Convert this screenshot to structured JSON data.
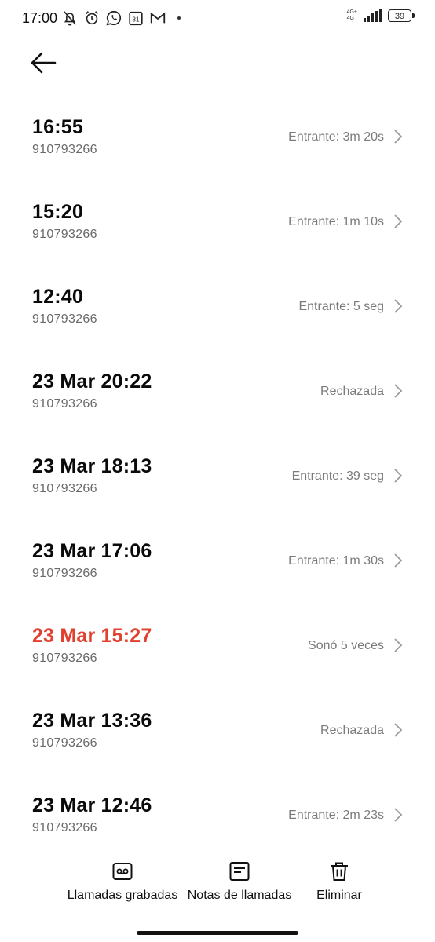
{
  "status_bar": {
    "time": "17:00",
    "battery": "39",
    "network_top": "4G+",
    "network_bottom": "4G",
    "icons": [
      "muted-notification-icon",
      "alarm-icon",
      "whatsapp-icon",
      "calendar-icon",
      "gmail-icon",
      "dot-icon"
    ]
  },
  "calendar_day": "31",
  "calls": [
    {
      "time": "16:55",
      "number": "910793266",
      "status": "Entrante: 3m 20s",
      "missed": false
    },
    {
      "time": "15:20",
      "number": "910793266",
      "status": "Entrante: 1m 10s",
      "missed": false
    },
    {
      "time": "12:40",
      "number": "910793266",
      "status": "Entrante: 5 seg",
      "missed": false
    },
    {
      "time": "23 Mar 20:22",
      "number": "910793266",
      "status": "Rechazada",
      "missed": false
    },
    {
      "time": "23 Mar 18:13",
      "number": "910793266",
      "status": "Entrante: 39 seg",
      "missed": false
    },
    {
      "time": "23 Mar 17:06",
      "number": "910793266",
      "status": "Entrante: 1m 30s",
      "missed": false
    },
    {
      "time": "23 Mar 15:27",
      "number": "910793266",
      "status": "Sonó 5 veces",
      "missed": true
    },
    {
      "time": "23 Mar 13:36",
      "number": "910793266",
      "status": "Rechazada",
      "missed": false
    },
    {
      "time": "23 Mar 12:46",
      "number": "910793266",
      "status": "Entrante: 2m 23s",
      "missed": false
    }
  ],
  "actions": {
    "recorded": "Llamadas grabadas",
    "notes": "Notas de llamadas",
    "delete": "Eliminar"
  },
  "colors": {
    "missed": "#e2412f",
    "secondary_text": "#7b7b7b"
  }
}
